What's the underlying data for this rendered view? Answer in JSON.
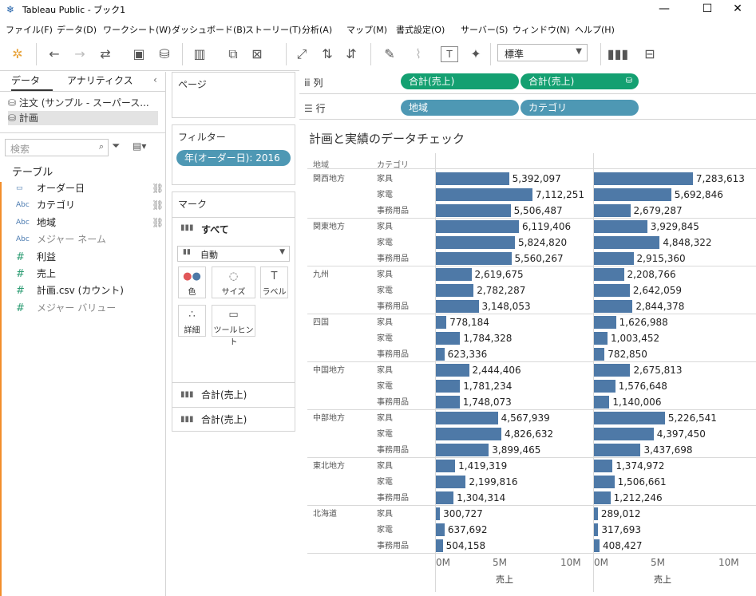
{
  "window": {
    "title": "Tableau Public - ブック1"
  },
  "menu": [
    "ファイル(F)",
    "データ(D)",
    "ワークシート(W)",
    "ダッシュボード(B)",
    "ストーリー(T)",
    "分析(A)",
    "マップ(M)",
    "書式設定(O)",
    "サーバー(S)",
    "ウィンドウ(N)",
    "ヘルプ(H)"
  ],
  "toolbar": {
    "fit_select": "標準"
  },
  "data_pane": {
    "tab_data": "データ",
    "tab_analytics": "アナリティクス",
    "datasources": [
      "注文 (サンプル - スーパース...",
      "計画"
    ],
    "search_placeholder": "検索",
    "table_heading": "テーブル",
    "fields": [
      {
        "type": "date",
        "name": "オーダー日",
        "gray": false,
        "linked": true
      },
      {
        "type": "Abc",
        "name": "カテゴリ",
        "gray": false,
        "linked": true
      },
      {
        "type": "Abc",
        "name": "地域",
        "gray": false,
        "linked": true
      },
      {
        "type": "Abc",
        "name": "メジャー ネーム",
        "gray": true,
        "linked": false
      },
      {
        "type": "#",
        "name": "利益",
        "gray": false,
        "linked": false
      },
      {
        "type": "#",
        "name": "売上",
        "gray": false,
        "linked": false
      },
      {
        "type": "#",
        "name": "計画.csv (カウント)",
        "gray": false,
        "linked": false
      },
      {
        "type": "#",
        "name": "メジャー バリュー",
        "gray": true,
        "linked": false
      }
    ]
  },
  "pages": {
    "label": "ページ"
  },
  "filters": {
    "label": "フィルター",
    "pill": "年(オーダー日): 2016"
  },
  "marks": {
    "label": "マーク",
    "all": "すべて",
    "type": "自動",
    "buttons": [
      "色",
      "サイズ",
      "ラベル",
      "詳細",
      "ツールヒント"
    ],
    "measures": [
      "合計(売上)",
      "合計(売上)"
    ]
  },
  "shelves": {
    "columns_label": "列",
    "rows_label": "行",
    "columns": [
      "合計(売上)",
      "合計(売上)"
    ],
    "rows": [
      "地域",
      "カテゴリ"
    ]
  },
  "viz": {
    "title": "計画と実績のデータチェック",
    "header_region": "地域",
    "header_category": "カテゴリ"
  },
  "chart_data": {
    "type": "bar",
    "orientation": "horizontal",
    "xlabel": "売上",
    "xlim": [
      0,
      10000000
    ],
    "ticks": [
      "0M",
      "5M",
      "10M"
    ],
    "color": "#4e79a7",
    "regions": [
      {
        "name": "関西地方",
        "rows": [
          {
            "category": "家具",
            "left": 5392097,
            "left_label": "5,392,097",
            "right": 7283613,
            "right_label": "7,283,613"
          },
          {
            "category": "家電",
            "left": 7112251,
            "left_label": "7,112,251",
            "right": 5692846,
            "right_label": "5,692,846"
          },
          {
            "category": "事務用品",
            "left": 5506487,
            "left_label": "5,506,487",
            "right": 2679287,
            "right_label": "2,679,287"
          }
        ]
      },
      {
        "name": "関東地方",
        "rows": [
          {
            "category": "家具",
            "left": 6119406,
            "left_label": "6,119,406",
            "right": 3929845,
            "right_label": "3,929,845"
          },
          {
            "category": "家電",
            "left": 5824820,
            "left_label": "5,824,820",
            "right": 4848322,
            "right_label": "4,848,322"
          },
          {
            "category": "事務用品",
            "left": 5560267,
            "left_label": "5,560,267",
            "right": 2915360,
            "right_label": "2,915,360"
          }
        ]
      },
      {
        "name": "九州",
        "rows": [
          {
            "category": "家具",
            "left": 2619675,
            "left_label": "2,619,675",
            "right": 2208766,
            "right_label": "2,208,766"
          },
          {
            "category": "家電",
            "left": 2782287,
            "left_label": "2,782,287",
            "right": 2642059,
            "right_label": "2,642,059"
          },
          {
            "category": "事務用品",
            "left": 3148053,
            "left_label": "3,148,053",
            "right": 2844378,
            "right_label": "2,844,378"
          }
        ]
      },
      {
        "name": "四国",
        "rows": [
          {
            "category": "家具",
            "left": 778184,
            "left_label": "778,184",
            "right": 1626988,
            "right_label": "1,626,988"
          },
          {
            "category": "家電",
            "left": 1784328,
            "left_label": "1,784,328",
            "right": 1003452,
            "right_label": "1,003,452"
          },
          {
            "category": "事務用品",
            "left": 623336,
            "left_label": "623,336",
            "right": 782850,
            "right_label": "782,850"
          }
        ]
      },
      {
        "name": "中国地方",
        "rows": [
          {
            "category": "家具",
            "left": 2444406,
            "left_label": "2,444,406",
            "right": 2675813,
            "right_label": "2,675,813"
          },
          {
            "category": "家電",
            "left": 1781234,
            "left_label": "1,781,234",
            "right": 1576648,
            "right_label": "1,576,648"
          },
          {
            "category": "事務用品",
            "left": 1748073,
            "left_label": "1,748,073",
            "right": 1140006,
            "right_label": "1,140,006"
          }
        ]
      },
      {
        "name": "中部地方",
        "rows": [
          {
            "category": "家具",
            "left": 4567939,
            "left_label": "4,567,939",
            "right": 5226541,
            "right_label": "5,226,541"
          },
          {
            "category": "家電",
            "left": 4826632,
            "left_label": "4,826,632",
            "right": 4397450,
            "right_label": "4,397,450"
          },
          {
            "category": "事務用品",
            "left": 3899465,
            "left_label": "3,899,465",
            "right": 3437698,
            "right_label": "3,437,698"
          }
        ]
      },
      {
        "name": "東北地方",
        "rows": [
          {
            "category": "家具",
            "left": 1419319,
            "left_label": "1,419,319",
            "right": 1374972,
            "right_label": "1,374,972"
          },
          {
            "category": "家電",
            "left": 2199816,
            "left_label": "2,199,816",
            "right": 1506661,
            "right_label": "1,506,661"
          },
          {
            "category": "事務用品",
            "left": 1304314,
            "left_label": "1,304,314",
            "right": 1212246,
            "right_label": "1,212,246"
          }
        ]
      },
      {
        "name": "北海道",
        "rows": [
          {
            "category": "家具",
            "left": 300727,
            "left_label": "300,727",
            "right": 289012,
            "right_label": "289,012"
          },
          {
            "category": "家電",
            "left": 637692,
            "left_label": "637,692",
            "right": 317693,
            "right_label": "317,693"
          },
          {
            "category": "事務用品",
            "left": 504158,
            "left_label": "504,158",
            "right": 408427,
            "right_label": "408,427"
          }
        ]
      }
    ]
  }
}
